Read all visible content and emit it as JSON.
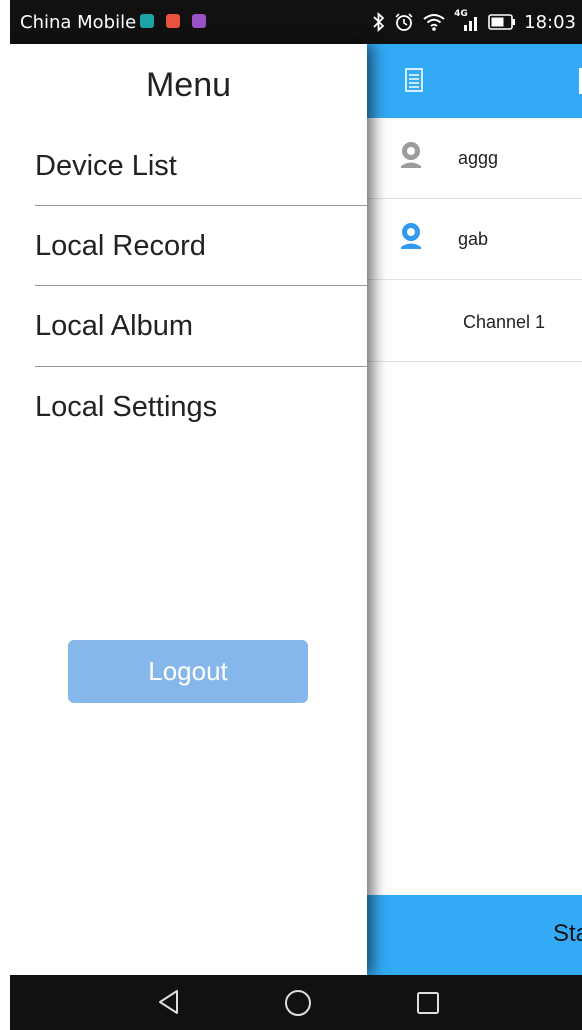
{
  "status_bar": {
    "carrier": "China Mobile",
    "network_label": "4G",
    "time": "18:03",
    "icons": [
      "app-notification-icon",
      "app-notification-icon",
      "app-notification-icon",
      "bluetooth-icon",
      "alarm-icon",
      "wifi-icon",
      "signal-icon",
      "battery-icon"
    ],
    "app_icon_colors": [
      "#1aa6a6",
      "#e8523f",
      "#9a52c8"
    ]
  },
  "drawer": {
    "title": "Menu",
    "items": [
      {
        "label": "Device List"
      },
      {
        "label": "Local Record"
      },
      {
        "label": "Local Album"
      },
      {
        "label": "Local Settings"
      }
    ],
    "logout_label": "Logout"
  },
  "app": {
    "accent_color": "#33aaf5",
    "devices": [
      {
        "name": "aggg",
        "status": "offline",
        "icon": "camera-icon"
      },
      {
        "name": "gab",
        "status": "online",
        "icon": "camera-icon"
      }
    ],
    "channel_label": "Channel 1",
    "bottom_button_label": "Sta"
  },
  "nav_bar": {
    "icons": [
      "back-icon",
      "home-icon",
      "recents-icon"
    ]
  }
}
